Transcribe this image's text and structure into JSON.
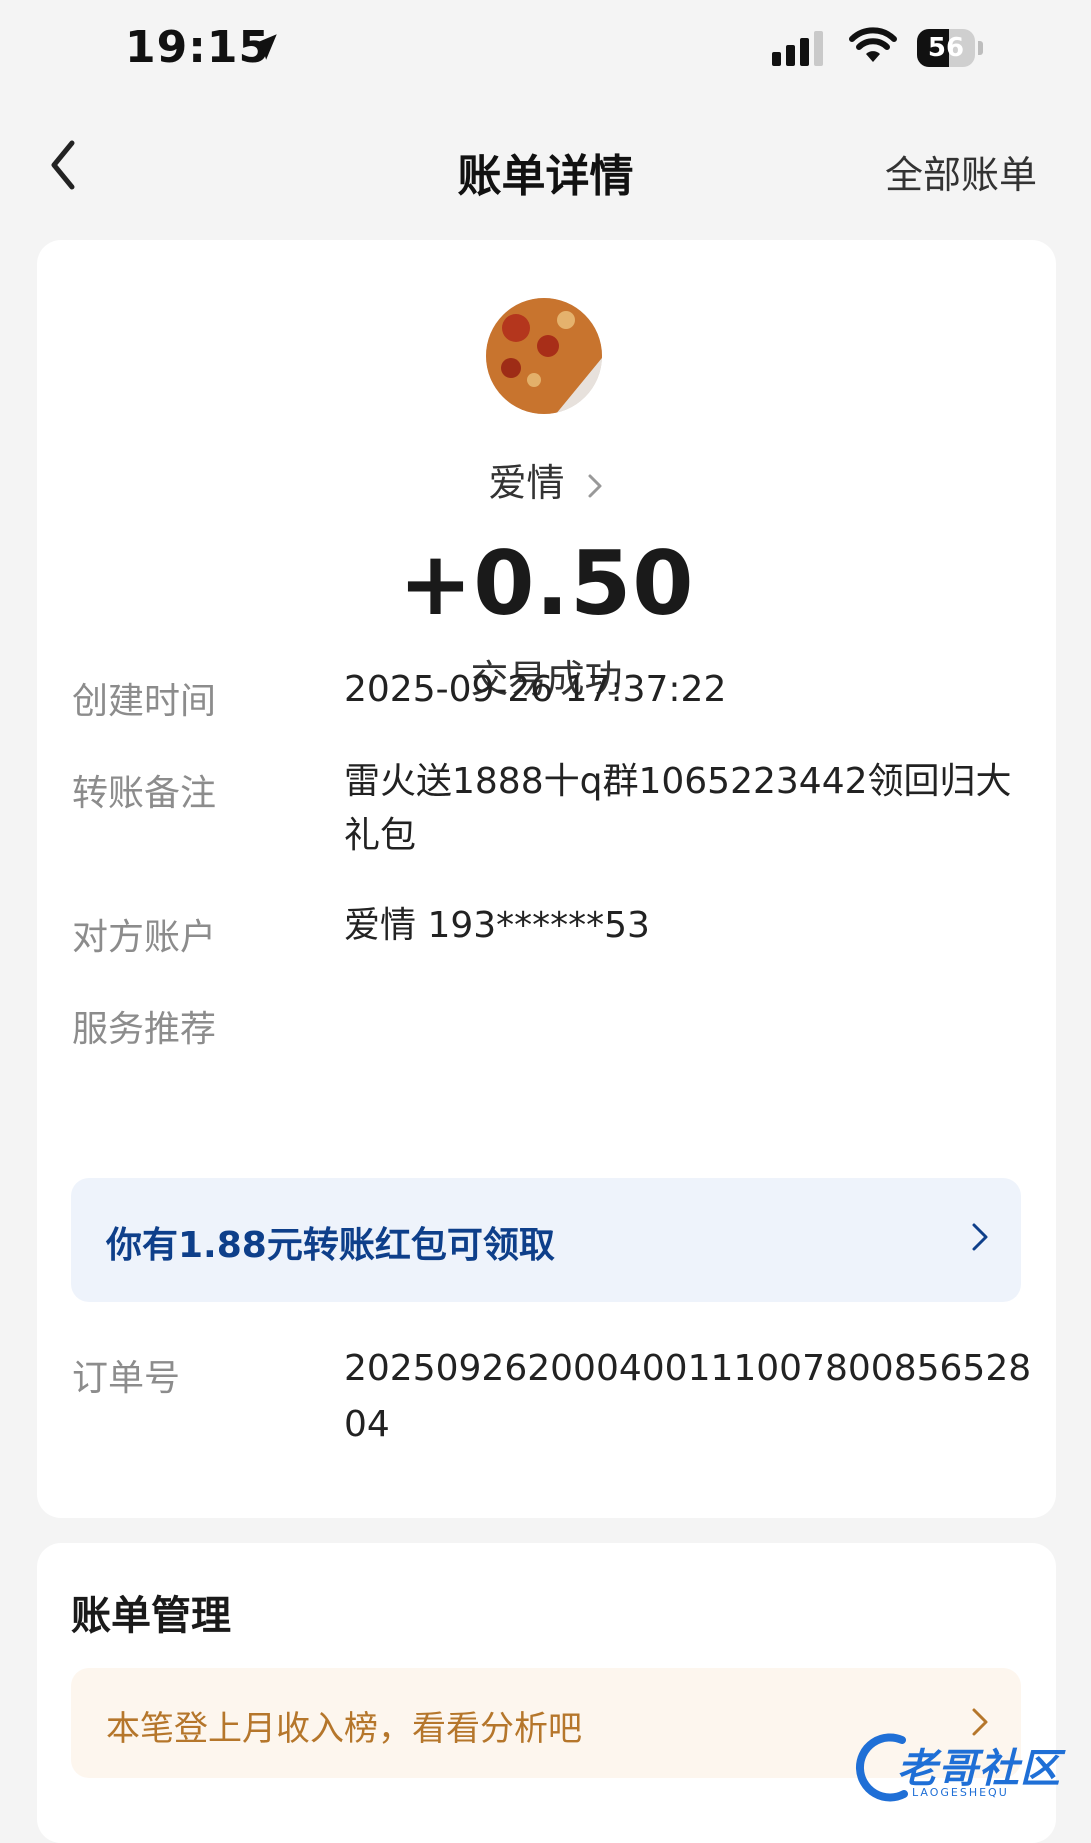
{
  "status_bar": {
    "time": "19:15",
    "battery": "56",
    "battery_level": 0.56,
    "icons": [
      "location-arrow-icon",
      "signal-icon",
      "wifi-icon",
      "battery-icon"
    ]
  },
  "nav": {
    "back_icon": "chevron-left-icon",
    "title": "账单详情",
    "right_label": "全部账单"
  },
  "transaction": {
    "payer_name": "爱情",
    "amount": "+0.50",
    "status": "交易成功",
    "details": [
      {
        "label": "创建时间",
        "value": "2025-09-26 17:37:22"
      },
      {
        "label": "转账备注",
        "value": "雷火送1888十q群1065223442领回归大礼包"
      },
      {
        "label": "对方账户",
        "value": "爱情 193******53"
      },
      {
        "label": "服务推荐",
        "value": ""
      }
    ],
    "promo": {
      "text": "你有1.88元转账红包可领取",
      "color": "#0e3f8a"
    },
    "order": {
      "label": "订单号",
      "value": "20250926200040011100780085652804"
    }
  },
  "bill_management": {
    "title": "账单管理",
    "promo": {
      "text": "本笔登上月收入榜，看看分析吧",
      "color": "#b5762b"
    }
  },
  "watermark": {
    "text": "老哥社区",
    "sub": "LAOGESHEQU"
  }
}
